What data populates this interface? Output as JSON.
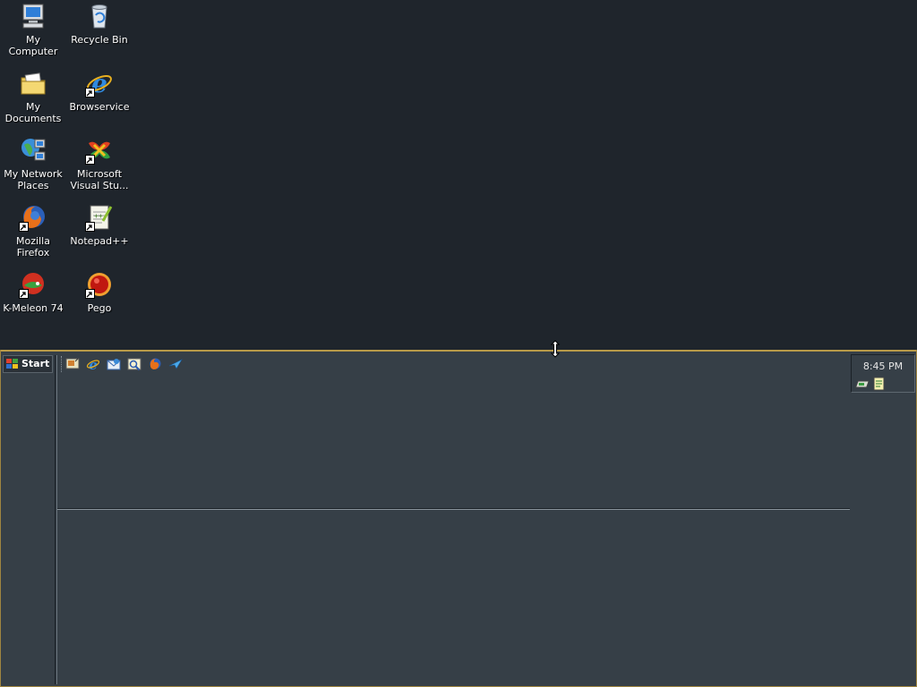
{
  "desktop": {
    "icons": [
      {
        "label": "My Computer",
        "icon": "my-computer-icon",
        "shortcut": false
      },
      {
        "label": "Recycle Bin",
        "icon": "recycle-bin-icon",
        "shortcut": false
      },
      {
        "label": "My Documents",
        "icon": "my-documents-icon",
        "shortcut": false
      },
      {
        "label": "Browservice",
        "icon": "internet-explorer-icon",
        "shortcut": true
      },
      {
        "label": "My Network Places",
        "icon": "network-places-icon",
        "shortcut": false
      },
      {
        "label": "Microsoft Visual Stu...",
        "icon": "visual-studio-icon",
        "shortcut": true
      },
      {
        "label": "Mozilla Firefox",
        "icon": "firefox-icon",
        "shortcut": true
      },
      {
        "label": "Notepad++",
        "icon": "notepad-plus-plus-icon",
        "shortcut": true
      },
      {
        "label": "K-Meleon 74",
        "icon": "k-meleon-icon",
        "shortcut": true
      },
      {
        "label": "Pego",
        "icon": "pego-icon",
        "shortcut": true
      }
    ]
  },
  "taskbar": {
    "start_label": "Start",
    "quick_launch": [
      "show-desktop-icon",
      "internet-explorer-icon",
      "outlook-express-icon",
      "windows-media-icon",
      "firefox-icon",
      "messenger-icon"
    ],
    "clock": "8:45 PM",
    "tray": [
      "network-icon",
      "notepad-icon"
    ]
  },
  "colors": {
    "desktop_bg": "#1f252c",
    "taskbar_bg": "#363f47",
    "taskbar_border": "#b89a48"
  }
}
